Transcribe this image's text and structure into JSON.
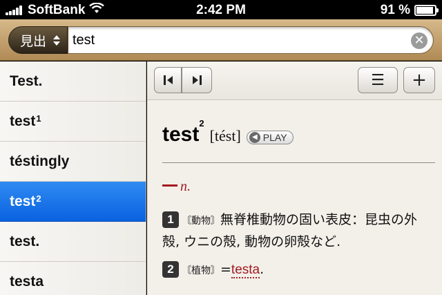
{
  "status_bar": {
    "carrier": "SoftBank",
    "time": "2:42 PM",
    "battery_text": "91 %",
    "battery_level": 0.91
  },
  "search": {
    "scope_label": "見出",
    "query": "test"
  },
  "results": [
    {
      "word": "Test.",
      "sup": ""
    },
    {
      "word": "test",
      "sup": "1"
    },
    {
      "word": "téstingly",
      "sup": ""
    },
    {
      "word": "test",
      "sup": "2",
      "selected": true
    },
    {
      "word": "test.",
      "sup": ""
    },
    {
      "word": "testa",
      "sup": ""
    }
  ],
  "toolbar": {
    "menu_label": "☰",
    "add_label": "+"
  },
  "entry": {
    "headword": "test",
    "headword_sup": "2",
    "pronunciation": "[tést]",
    "play_label": "PLAY",
    "pos": "n.",
    "senses": [
      {
        "number": "1",
        "tag": "〘動物〙",
        "text": "無脊椎動物の固い表皮：昆虫の外殻, ウニの殻, 動物の卵殻など."
      },
      {
        "number": "2",
        "tag": "〘植物〙",
        "text_before": "=",
        "xref": "testa",
        "text_after": "."
      }
    ]
  },
  "colors": {
    "selection": "#1a73e8",
    "accent_red": "#a3191e",
    "search_bar": "#c4a06b"
  }
}
